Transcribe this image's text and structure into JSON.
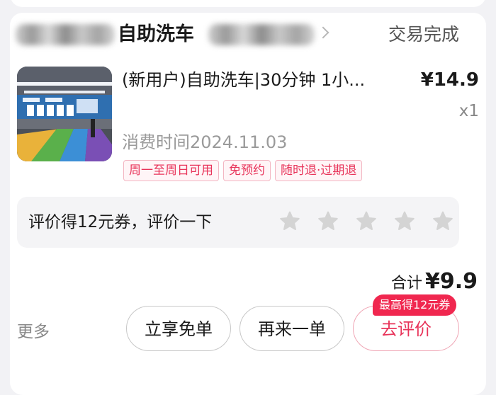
{
  "order": {
    "shop_name": "自助洗车",
    "status": "交易完成",
    "product_title": "(新用户)自助洗车|30分钟 1小...",
    "price": "¥14.9",
    "quantity": "x1",
    "consume_time": "消费时间2024.11.03",
    "tags": [
      "周一至周日可用",
      "免预约",
      "随时退·过期退"
    ]
  },
  "review": {
    "prompt": "评价得12元券，评价一下",
    "star_count": 5,
    "rating": 0
  },
  "total": {
    "label": "合计",
    "amount": "¥9.9"
  },
  "actions": {
    "more": "更多",
    "free_button": "立享免单",
    "again_button": "再来一单",
    "review_button": "去评价",
    "review_badge": "最高得12元券"
  },
  "colors": {
    "accent": "#e8345a",
    "badge": "#f0274f",
    "star": "#d4d4d4"
  }
}
